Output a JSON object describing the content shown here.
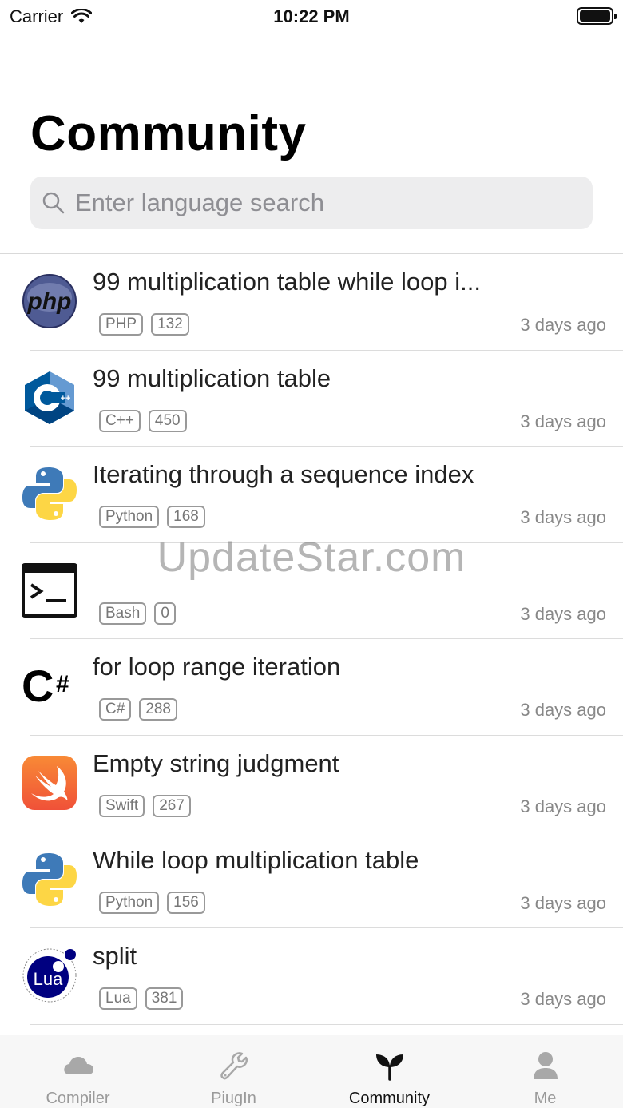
{
  "status_bar": {
    "carrier": "Carrier",
    "time": "10:22 PM",
    "battery_level": 1.0
  },
  "page": {
    "title": "Community"
  },
  "search": {
    "placeholder": "Enter language search"
  },
  "watermark": "UpdateStar.com",
  "items": [
    {
      "icon": "php-icon",
      "title": "99 multiplication table while loop i...",
      "language": "PHP",
      "count": "132",
      "time": "3 days ago"
    },
    {
      "icon": "cpp-icon",
      "title": "99 multiplication table",
      "language": "C++",
      "count": "450",
      "time": "3 days ago"
    },
    {
      "icon": "python-icon",
      "title": "Iterating through a sequence index",
      "language": "Python",
      "count": "168",
      "time": "3 days ago"
    },
    {
      "icon": "bash-terminal-icon",
      "title": "",
      "language": "Bash",
      "count": "0",
      "time": "3 days ago"
    },
    {
      "icon": "csharp-icon",
      "title": "for loop range iteration",
      "language": "C#",
      "count": "288",
      "time": "3 days ago"
    },
    {
      "icon": "swift-icon",
      "title": "Empty string judgment",
      "language": "Swift",
      "count": "267",
      "time": "3 days ago"
    },
    {
      "icon": "python-icon",
      "title": "While loop multiplication table",
      "language": "Python",
      "count": "156",
      "time": "3 days ago"
    },
    {
      "icon": "lua-icon",
      "title": "split",
      "language": "Lua",
      "count": "381",
      "time": "3 days ago"
    }
  ],
  "tabbar": {
    "tabs": [
      {
        "label": "Compiler",
        "icon": "cloud-icon",
        "active": false
      },
      {
        "label": "PiugIn",
        "icon": "wrench-icon",
        "active": false
      },
      {
        "label": "Community",
        "icon": "sprout-icon",
        "active": true
      },
      {
        "label": "Me",
        "icon": "person-icon",
        "active": false
      }
    ]
  },
  "colors": {
    "accent_text": "#111111",
    "inactive_tab": "#9a9a9a",
    "tag_border": "#999999",
    "swift_orange": "#f05138",
    "lua_blue": "#000080"
  }
}
